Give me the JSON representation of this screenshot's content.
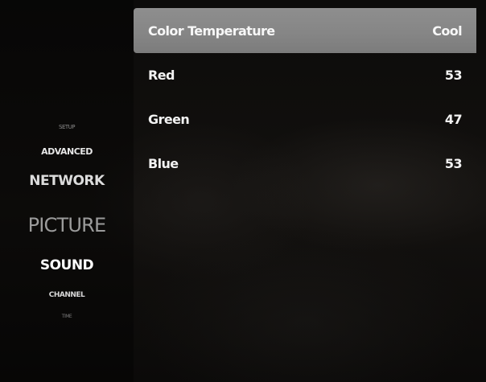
{
  "nav": {
    "items": [
      {
        "id": "setup",
        "label": "SETUP"
      },
      {
        "id": "advanced",
        "label": "ADVANCED"
      },
      {
        "id": "network",
        "label": "NETWORK"
      },
      {
        "id": "picture",
        "label": "PICTURE"
      },
      {
        "id": "sound",
        "label": "SOUND"
      },
      {
        "id": "channel",
        "label": "CHANNEL"
      },
      {
        "id": "time",
        "label": "TIME"
      }
    ]
  },
  "settings": {
    "rows": [
      {
        "label": "Color Temperature",
        "value": "Cool"
      },
      {
        "label": "Red",
        "value": "53"
      },
      {
        "label": "Green",
        "value": "47"
      },
      {
        "label": "Blue",
        "value": "53"
      }
    ]
  }
}
